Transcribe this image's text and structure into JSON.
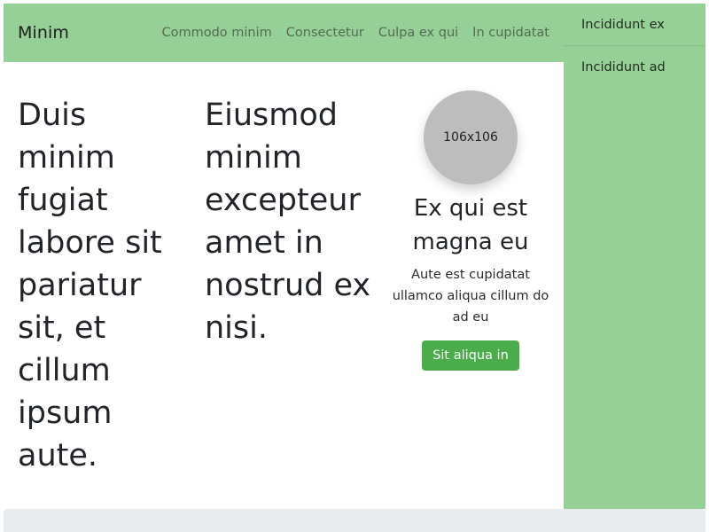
{
  "navbar": {
    "brand": "Minim",
    "links": [
      "Commodo minim",
      "Consectetur",
      "Culpa ex qui",
      "In cupidatat"
    ]
  },
  "sidebar": {
    "items": [
      "Incididunt ex",
      "Incididunt ad"
    ]
  },
  "content": {
    "column1_heading": "Duis minim fugiat labore sit pariatur sit, et cillum ipsum aute.",
    "column2_heading": "Eiusmod minim excepteur amet in nostrud ex nisi.",
    "card": {
      "image_label": "106x106",
      "title": "Ex qui est magna eu",
      "text": "Aute est cupidatat ullamco aliqua cillum do ad eu",
      "button_label": "Sit aliqua in"
    }
  },
  "colors": {
    "nav_bg": "#96d096",
    "button_bg": "#4aac4a",
    "footer_bg": "#e9ecef"
  }
}
